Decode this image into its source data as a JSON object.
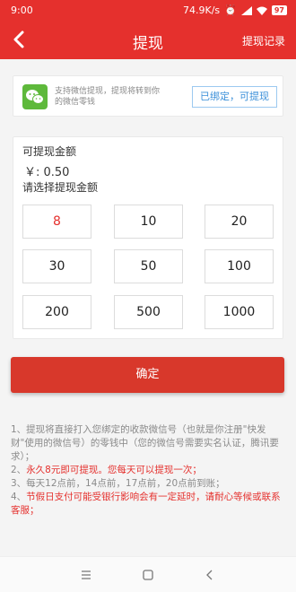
{
  "status_bar": {
    "time": "9:00",
    "network_speed": "74.9K/s",
    "battery": "97"
  },
  "header": {
    "title": "提现",
    "record_link": "提现记录"
  },
  "wechat_card": {
    "description": "支持微信提现，提现将转到你的微信零钱",
    "status_button": "已绑定，可提现",
    "icon": "wechat-icon"
  },
  "amount_card": {
    "label": "可提现金额",
    "balance": "￥: 0.50",
    "choose_label": "请选择提现金额",
    "options": [
      "8",
      "10",
      "20",
      "30",
      "50",
      "100",
      "200",
      "500",
      "1000"
    ],
    "selected": "8"
  },
  "confirm_button": "确定",
  "notes": {
    "n1": "1、提现将直接打入您绑定的收款微信号（也就是你注册\"快发财\"使用的微信号）的零钱中（您的微信号需要实名认证，腾讯要求）；",
    "n2_prefix": "2、",
    "n2_red": "永久8元即可提现。您每天可以提现一次；",
    "n3": "3、每天12点前，14点前，17点前，20点前到账；",
    "n4_prefix": "4、",
    "n4_red": "节假日支付可能受银行影响会有一定延时，请耐心等候或联系客服；"
  },
  "colors": {
    "primary": "#e5302d",
    "link": "#3a8fd9",
    "wechat": "#5eb93b"
  }
}
